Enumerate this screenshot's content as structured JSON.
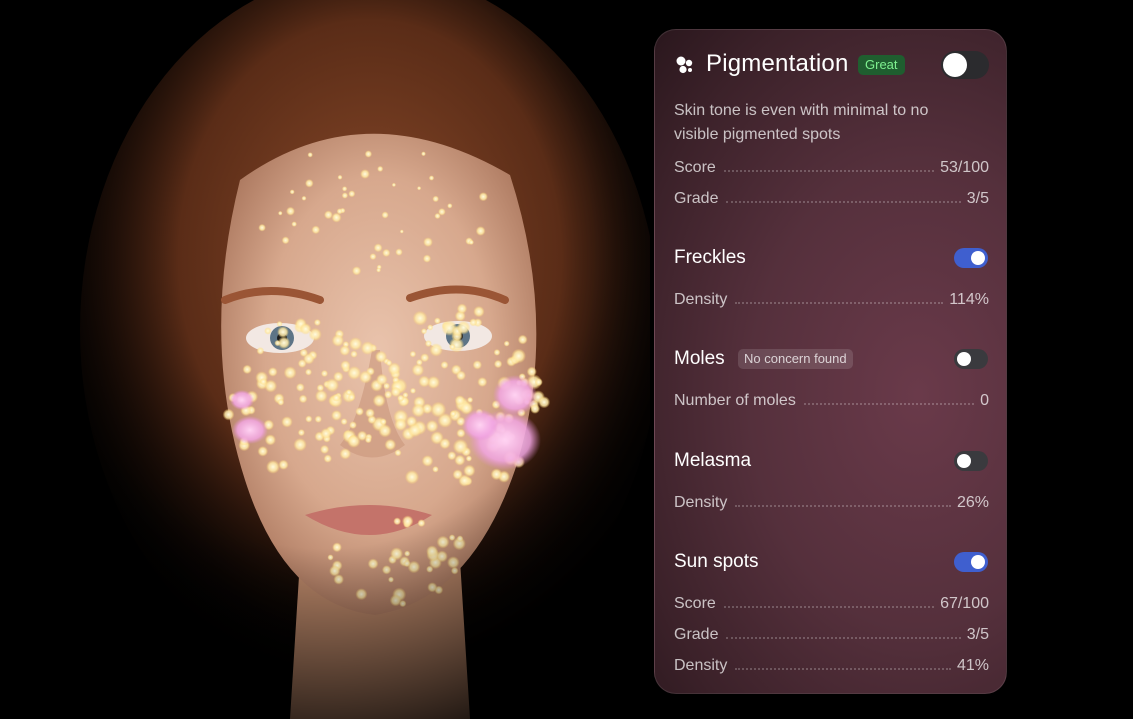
{
  "colors": {
    "panel_bg": "#55303c",
    "badge_great_bg": "#1f5e2f",
    "badge_great_text": "#7ef08f",
    "toggle_on": "#3f5fcf",
    "toggle_off": "#3a3a3e"
  },
  "panel": {
    "icon": "pigmentation-dots-icon",
    "title": "Pigmentation",
    "badge": "Great",
    "master_toggle_on": false,
    "description": "Skin tone is even with minimal to no visible pigmented spots",
    "score_label": "Score",
    "score_value": "53/100",
    "grade_label": "Grade",
    "grade_value": "3/5"
  },
  "sections": {
    "freckles": {
      "title": "Freckles",
      "toggle_on": true,
      "density_label": "Density",
      "density_value": "114%"
    },
    "moles": {
      "title": "Moles",
      "badge": "No concern found",
      "toggle_on": false,
      "count_label": "Number of moles",
      "count_value": "0"
    },
    "melasma": {
      "title": "Melasma",
      "toggle_on": false,
      "density_label": "Density",
      "density_value": "26%"
    },
    "sun_spots": {
      "title": "Sun spots",
      "toggle_on": true,
      "score_label": "Score",
      "score_value": "67/100",
      "grade_label": "Grade",
      "grade_value": "3/5",
      "density_label": "Density",
      "density_value": "41%"
    }
  }
}
